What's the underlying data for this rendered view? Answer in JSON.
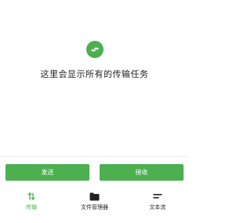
{
  "colors": {
    "accent": "#4caf50",
    "text": "#222222",
    "background": "#ffffff"
  },
  "empty_state": {
    "icon": "transfer-arrows-icon",
    "message": "这里会显示所有的传输任务"
  },
  "actions": {
    "send_label": "发送",
    "receive_label": "接收"
  },
  "bottom_nav": {
    "items": [
      {
        "label": "传输",
        "icon": "transfer-arrows-icon",
        "active": true
      },
      {
        "label": "文件管理器",
        "icon": "folder-icon",
        "active": false
      },
      {
        "label": "文本流",
        "icon": "text-lines-icon",
        "active": false
      }
    ]
  }
}
